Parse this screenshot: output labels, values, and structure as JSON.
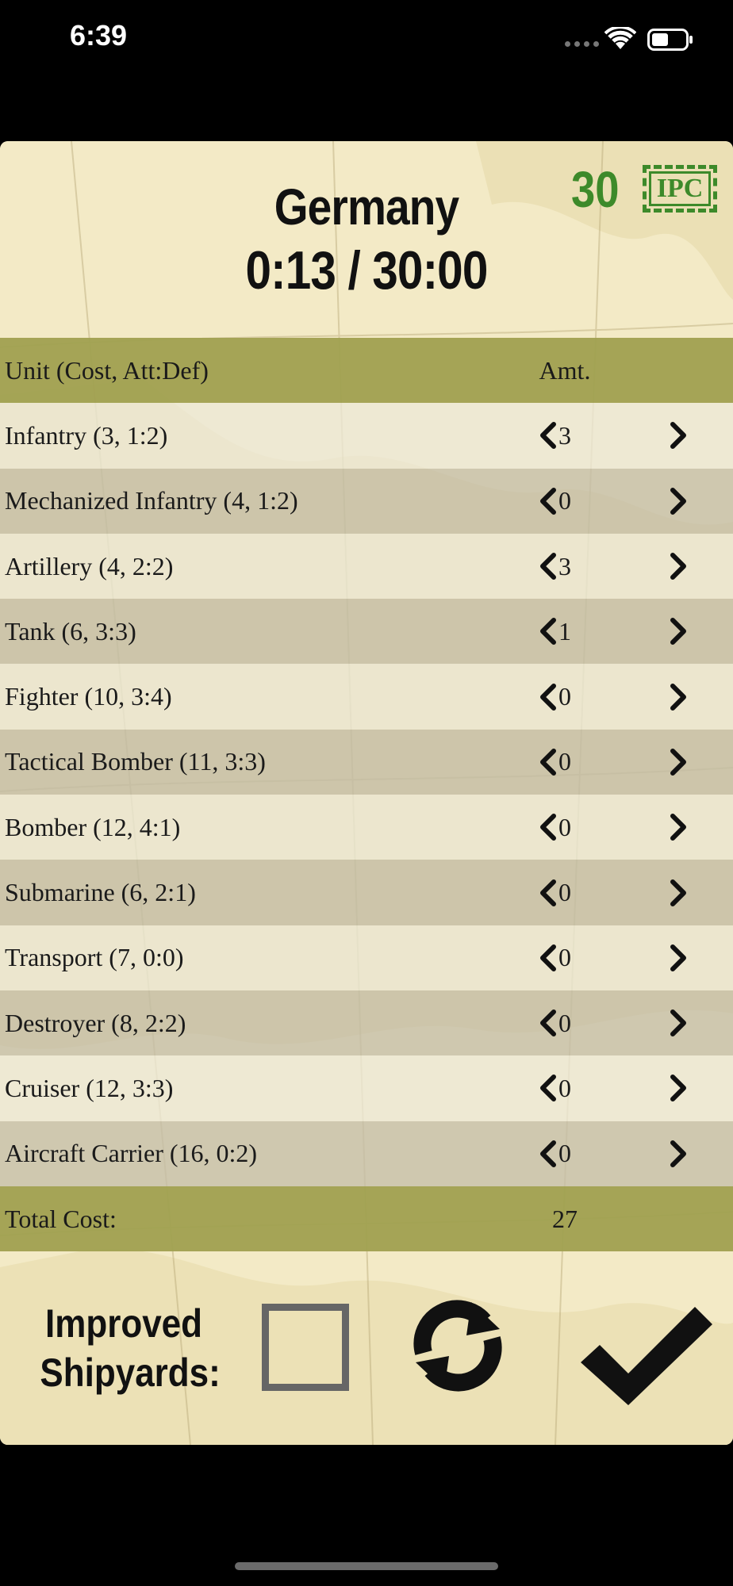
{
  "status_bar": {
    "time": "6:39"
  },
  "header": {
    "country": "Germany",
    "timer": "0:13 / 30:00",
    "ipc_amount": "30",
    "ipc_label": "IPC",
    "ipc_color": "#3d8a2a"
  },
  "table": {
    "header": {
      "unit_label": "Unit (Cost, Att:Def)",
      "amount_label": "Amt."
    },
    "rows": [
      {
        "label": "Infantry (3, 1:2)",
        "amount": "3"
      },
      {
        "label": "Mechanized Infantry (4, 1:2)",
        "amount": "0"
      },
      {
        "label": "Artillery (4, 2:2)",
        "amount": "3"
      },
      {
        "label": "Tank (6, 3:3)",
        "amount": "1"
      },
      {
        "label": "Fighter (10, 3:4)",
        "amount": "0"
      },
      {
        "label": "Tactical Bomber (11, 3:3)",
        "amount": "0"
      },
      {
        "label": "Bomber (12, 4:1)",
        "amount": "0"
      },
      {
        "label": "Submarine (6, 2:1)",
        "amount": "0"
      },
      {
        "label": "Transport (7, 0:0)",
        "amount": "0"
      },
      {
        "label": "Destroyer (8, 2:2)",
        "amount": "0"
      },
      {
        "label": "Cruiser (12, 3:3)",
        "amount": "0"
      },
      {
        "label": "Aircraft Carrier (16, 0:2)",
        "amount": "0"
      }
    ],
    "total": {
      "label": "Total Cost:",
      "value": "27"
    }
  },
  "footer": {
    "improved_shipyards_line1": "Improved",
    "improved_shipyards_line2": "Shipyards:",
    "improved_shipyards_checked": false
  },
  "icons": {
    "decrement": "chevron-left-icon",
    "increment": "chevron-right-icon",
    "reset": "refresh-icon",
    "confirm": "checkmark-icon"
  },
  "colors": {
    "header_row": "#a0a050",
    "panel_bg": "#f4ecc8"
  }
}
